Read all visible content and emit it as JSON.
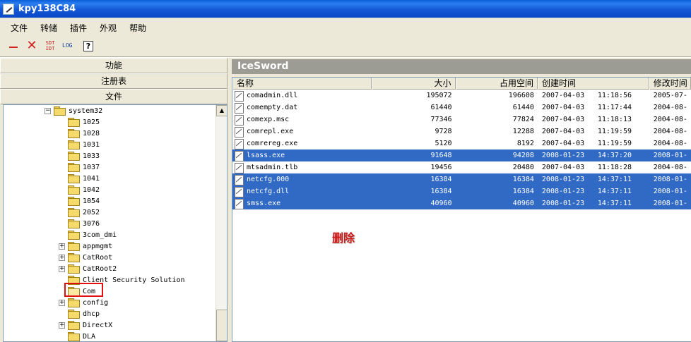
{
  "window": {
    "title": "kpy138C84"
  },
  "menu": [
    "文件",
    "转储",
    "插件",
    "外观",
    "帮助"
  ],
  "toolbar": {
    "buttons": [
      {
        "icon": "minus-icon"
      },
      {
        "icon": "close-x-icon"
      },
      {
        "icon": "sdt-icon",
        "label": "SDT\nIDT"
      },
      {
        "icon": "log-icon",
        "label": "LOG"
      },
      {
        "icon": "help-icon",
        "label": "?"
      }
    ]
  },
  "nav": {
    "function": "功能",
    "registry": "注册表",
    "file": "文件"
  },
  "tree": {
    "items": [
      {
        "label": "system32",
        "expander": "−"
      },
      {
        "label": "1025"
      },
      {
        "label": "1028"
      },
      {
        "label": "1031"
      },
      {
        "label": "1033"
      },
      {
        "label": "1037"
      },
      {
        "label": "1041"
      },
      {
        "label": "1042"
      },
      {
        "label": "1054"
      },
      {
        "label": "2052"
      },
      {
        "label": "3076"
      },
      {
        "label": "3com_dmi"
      },
      {
        "label": "appmgmt",
        "expander": "+"
      },
      {
        "label": "CatRoot",
        "expander": "+"
      },
      {
        "label": "CatRoot2",
        "expander": "+"
      },
      {
        "label": "Client Security Solution"
      },
      {
        "label": "Com"
      },
      {
        "label": "config",
        "expander": "+"
      },
      {
        "label": "dhcp"
      },
      {
        "label": "DirectX",
        "expander": "+"
      },
      {
        "label": "DLA"
      }
    ]
  },
  "panel": {
    "title": "IceSword"
  },
  "list": {
    "columns": [
      "名称",
      "大小",
      "占用空间",
      "创建时间",
      "修改时间"
    ],
    "rows": [
      {
        "name": "comadmin.dll",
        "size": "195072",
        "alloc": "196608",
        "cdate": "2007-04-03",
        "ctime": "11:18:56",
        "mdate": "2005-07-",
        "selected": false
      },
      {
        "name": "comempty.dat",
        "size": "61440",
        "alloc": "61440",
        "cdate": "2007-04-03",
        "ctime": "11:17:44",
        "mdate": "2004-08-",
        "selected": false
      },
      {
        "name": "comexp.msc",
        "size": "77346",
        "alloc": "77824",
        "cdate": "2007-04-03",
        "ctime": "11:18:13",
        "mdate": "2004-08-",
        "selected": false
      },
      {
        "name": "comrepl.exe",
        "size": "9728",
        "alloc": "12288",
        "cdate": "2007-04-03",
        "ctime": "11:19:59",
        "mdate": "2004-08-",
        "selected": false
      },
      {
        "name": "comrereg.exe",
        "size": "5120",
        "alloc": "8192",
        "cdate": "2007-04-03",
        "ctime": "11:19:59",
        "mdate": "2004-08-",
        "selected": false
      },
      {
        "name": "lsass.exe",
        "size": "91648",
        "alloc": "94208",
        "cdate": "2008-01-23",
        "ctime": "14:37:20",
        "mdate": "2008-01-",
        "selected": true
      },
      {
        "name": "mtsadmin.tlb",
        "size": "19456",
        "alloc": "20480",
        "cdate": "2007-04-03",
        "ctime": "11:18:28",
        "mdate": "2004-08-",
        "selected": false
      },
      {
        "name": "netcfg.000",
        "size": "16384",
        "alloc": "16384",
        "cdate": "2008-01-23",
        "ctime": "14:37:11",
        "mdate": "2008-01-",
        "selected": true
      },
      {
        "name": "netcfg.dll",
        "size": "16384",
        "alloc": "16384",
        "cdate": "2008-01-23",
        "ctime": "14:37:11",
        "mdate": "2008-01-",
        "selected": true
      },
      {
        "name": "smss.exe",
        "size": "40960",
        "alloc": "40960",
        "cdate": "2008-01-23",
        "ctime": "14:37:11",
        "mdate": "2008-01-",
        "selected": true
      }
    ]
  },
  "annotation": {
    "text": "删除",
    "color": "#d01818"
  },
  "colors": {
    "selection": "#316ac5",
    "titlebar": "#0a47c8"
  }
}
